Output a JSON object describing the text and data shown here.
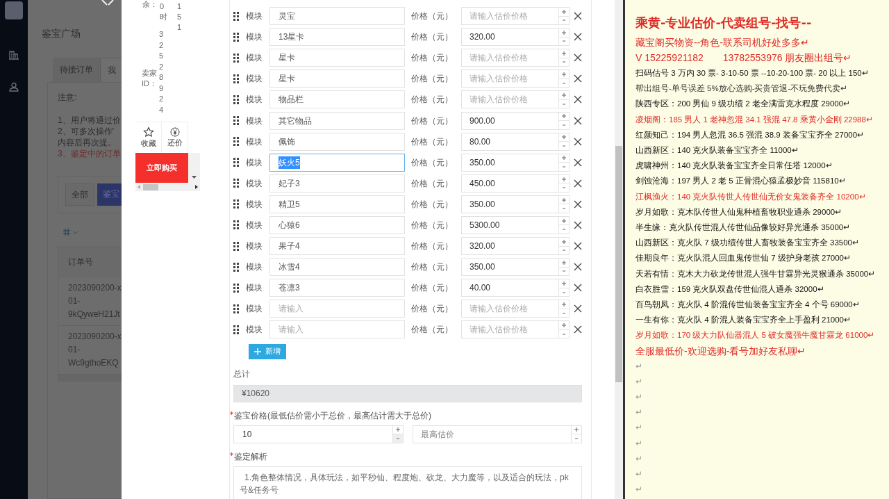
{
  "sidebar": {
    "items": [
      {
        "kind": "logo"
      },
      {
        "kind": "building"
      },
      {
        "kind": "user"
      }
    ]
  },
  "background_page": {
    "title": "鉴宝广场",
    "tabs": [
      {
        "label": "待接订单",
        "selected": false
      },
      {
        "label": "我",
        "selected": true
      }
    ],
    "notice": {
      "heading": "注意:",
      "lines": [
        {
          "text": "1、用户将通过价",
          "kind": "normal"
        },
        {
          "text": "2、可多次操作'",
          "kind": "normal"
        },
        {
          "text": "内容后再次提。",
          "kind": "normal"
        },
        {
          "text": "3、鉴定中的订单",
          "kind": "warning"
        }
      ]
    },
    "filters": [
      {
        "label": "全部",
        "selected": false
      },
      {
        "label": "鉴宝",
        "selected": true
      }
    ],
    "table": {
      "columns": [
        "订单号"
      ],
      "rows": [
        [
          "2023090200-x",
          "01-",
          "9kQyweH21Jt"
        ],
        [
          "2023090200-x",
          "01-",
          "Wc9gthoEKQ"
        ]
      ]
    }
  },
  "product_card": {
    "info_columns": [
      {
        "text": "余："
      },
      {
        "text": "0时"
      },
      {
        "text": "151"
      },
      {
        "text": "卖家ID："
      },
      {
        "text": "32528924"
      }
    ],
    "actions": [
      {
        "label": "收藏",
        "kind": "star"
      },
      {
        "label": "还价",
        "kind": "yen"
      }
    ],
    "buy_button": "立即购买"
  },
  "form": {
    "rows": [
      {
        "label": "模块",
        "name": "灵宝",
        "price_label": "价格（元）",
        "price_placeholder": "请输入估价价格",
        "selected": false
      },
      {
        "label": "模块",
        "name": "13星卡",
        "price_label": "价格（元）",
        "price": "320.00",
        "selected": false
      },
      {
        "label": "模块",
        "name": "星卡",
        "price_label": "价格（元）",
        "price_placeholder": "请输入估价价格",
        "selected": false
      },
      {
        "label": "模块",
        "name": "星卡",
        "price_label": "价格（元）",
        "price_placeholder": "请输入估价价格",
        "selected": false
      },
      {
        "label": "模块",
        "name": "物品栏",
        "price_label": "价格（元）",
        "price_placeholder": "请输入估价价格",
        "selected": false
      },
      {
        "label": "模块",
        "name": "其它物品",
        "price_label": "价格（元）",
        "price": "900.00",
        "selected": false
      },
      {
        "label": "模块",
        "name": "佩饰",
        "price_label": "价格（元）",
        "price": "80.00",
        "selected": false
      },
      {
        "label": "模块",
        "name": "妖火5",
        "price_label": "价格（元）",
        "price": "350.00",
        "selected": true
      },
      {
        "label": "模块",
        "name": "妃子3",
        "price_label": "价格（元）",
        "price": "450.00",
        "selected": false
      },
      {
        "label": "模块",
        "name": "精卫5",
        "price_label": "价格（元）",
        "price": "350.00",
        "selected": false
      },
      {
        "label": "模块",
        "name": "心猿6",
        "price_label": "价格（元）",
        "price": "5300.00",
        "selected": false
      },
      {
        "label": "模块",
        "name": "果子4",
        "price_label": "价格（元）",
        "price": "320.00",
        "selected": false
      },
      {
        "label": "模块",
        "name": "冰雪4",
        "price_label": "价格（元）",
        "price": "350.00",
        "selected": false
      },
      {
        "label": "模块",
        "name": "苍凛3",
        "price_label": "价格（元）",
        "price": "40.00",
        "selected": false
      },
      {
        "label": "模块",
        "name_placeholder": "请输入",
        "price_label": "价格（元）",
        "price_placeholder": "请输入估价价格",
        "selected": false
      },
      {
        "label": "模块",
        "name_placeholder": "请输入",
        "price_label": "价格（元）",
        "price_placeholder": "请输入估价价格",
        "selected": false
      }
    ],
    "add_button": "新增",
    "total": {
      "label": "总计",
      "value": "¥10620"
    },
    "appraisal_price": {
      "label": "鉴宝价格(最低估价需小于总价，最高估计需大于总价)",
      "required": true,
      "min_value": "10",
      "max_placeholder": "最高估价"
    },
    "analysis": {
      "label": "鉴定解析",
      "required": true,
      "placeholder": "1.角色整体情况，具体玩法，如平秒仙、程度炮、砍龙、大力魔等，以及适合的玩法，pk号&任务号"
    }
  },
  "ad_panel": {
    "lines": [
      {
        "text": "乘黄-专业估价-代卖组号-找号--",
        "kind": "heading",
        "color": "#e02a25"
      },
      {
        "text": "藏宝阁买物资--角色-联系司机好处多多↵",
        "kind": "large",
        "color": "#e02a25"
      },
      {
        "text": "V 15225921182　　13782553976 朋友圈出组号↵",
        "kind": "large",
        "color": "#e02a25"
      },
      {
        "text": "扫码估号 3 万内 30 票- 3-10-50 票  --10-20-100 票- 20 以上 150↵",
        "kind": "body",
        "color": "#111111"
      },
      {
        "text": "帮出组号-单号误差 5%放心选购-买贵管退-不玩免费代卖↵",
        "kind": "body",
        "color": "#333333"
      },
      {
        "text": "陕西专区：200 男仙 9 级功绩 2 老全满雷克水程度 29000↵",
        "kind": "body",
        "color": "#111111"
      },
      {
        "text": "凌烟阁：185 男人 1 老神忽混 34.1 强混 47.8 乘黄小金刚 22988↵",
        "kind": "body",
        "color": "#e02a25"
      },
      {
        "text": "红颜知己：194 男人忽混 36.5 强混 38.9 装备宝宝齐全 27000↵",
        "kind": "body",
        "color": "#111111"
      },
      {
        "text": "山西新区：140 克火队装备宝宝齐全 11000↵",
        "kind": "body",
        "color": "#111111"
      },
      {
        "text": "虎啸神州：140 克火队装备宝宝齐全日常任塔 12000↵",
        "kind": "body",
        "color": "#111111"
      },
      {
        "text": "剑蚀沧海：197 男人 2 老 5 正骨混心猿孟极妙音 115810↵",
        "kind": "body",
        "color": "#111111"
      },
      {
        "text": "江枫渔火：140 克火队传世人传世仙无价女鬼装备齐全 10200↵",
        "kind": "body",
        "color": "#e02a25"
      },
      {
        "text": "岁月如歌：克木队传世人仙鬼种植畜牧职业通杀 29000↵",
        "kind": "body",
        "color": "#111111"
      },
      {
        "text": "半生缘：克火队传世混人传世仙品像较好异光通杀 35000↵",
        "kind": "body",
        "color": "#111111"
      },
      {
        "text": "山西新区：克火队 7 级功绩传世人畜牧装备宝宝齐全 33500↵",
        "kind": "body",
        "color": "#111111"
      },
      {
        "text": "佳期良年：克火队混人回血鬼传世仙 7 级护身老孩 27000↵",
        "kind": "body",
        "color": "#111111"
      },
      {
        "text": "天若有情：克木大力砍龙传世混人强牛甘霖异光灵猴通杀 35000↵",
        "kind": "body",
        "color": "#111111"
      },
      {
        "text": "白衣胜雪：159 克火队双盘传世仙混人通杀 32000↵",
        "kind": "body",
        "color": "#111111"
      },
      {
        "text": "百鸟朝凤：克火队 4 阶混传世仙装备宝宝齐全 4 个号 69000↵",
        "kind": "body",
        "color": "#111111"
      },
      {
        "text": "一生有你：克火队 4 阶混人装备宝宝齐全上手盈利 21000↵",
        "kind": "body",
        "color": "#111111"
      },
      {
        "text": "岁月如歌：170 级大力队仙器混人 5 破女魔强牛魔甘霖龙 61000↵",
        "kind": "body",
        "color": "#e02a25"
      },
      {
        "text": "全服最低价-欢迎选购-看号加好友私聊↵",
        "kind": "large",
        "color": "#e02a25"
      },
      {
        "text": "↵",
        "kind": "body",
        "color": "#999999"
      },
      {
        "text": "↵",
        "kind": "body",
        "color": "#999999"
      },
      {
        "text": "↵",
        "kind": "body",
        "color": "#999999"
      },
      {
        "text": "↵",
        "kind": "body",
        "color": "#999999"
      },
      {
        "text": "↵",
        "kind": "body",
        "color": "#999999"
      },
      {
        "text": "↵",
        "kind": "body",
        "color": "#999999"
      },
      {
        "text": "↵",
        "kind": "body",
        "color": "#999999"
      },
      {
        "text": "↵",
        "kind": "body",
        "color": "#999999"
      },
      {
        "text": "↵",
        "kind": "body",
        "color": "#999999"
      }
    ]
  }
}
